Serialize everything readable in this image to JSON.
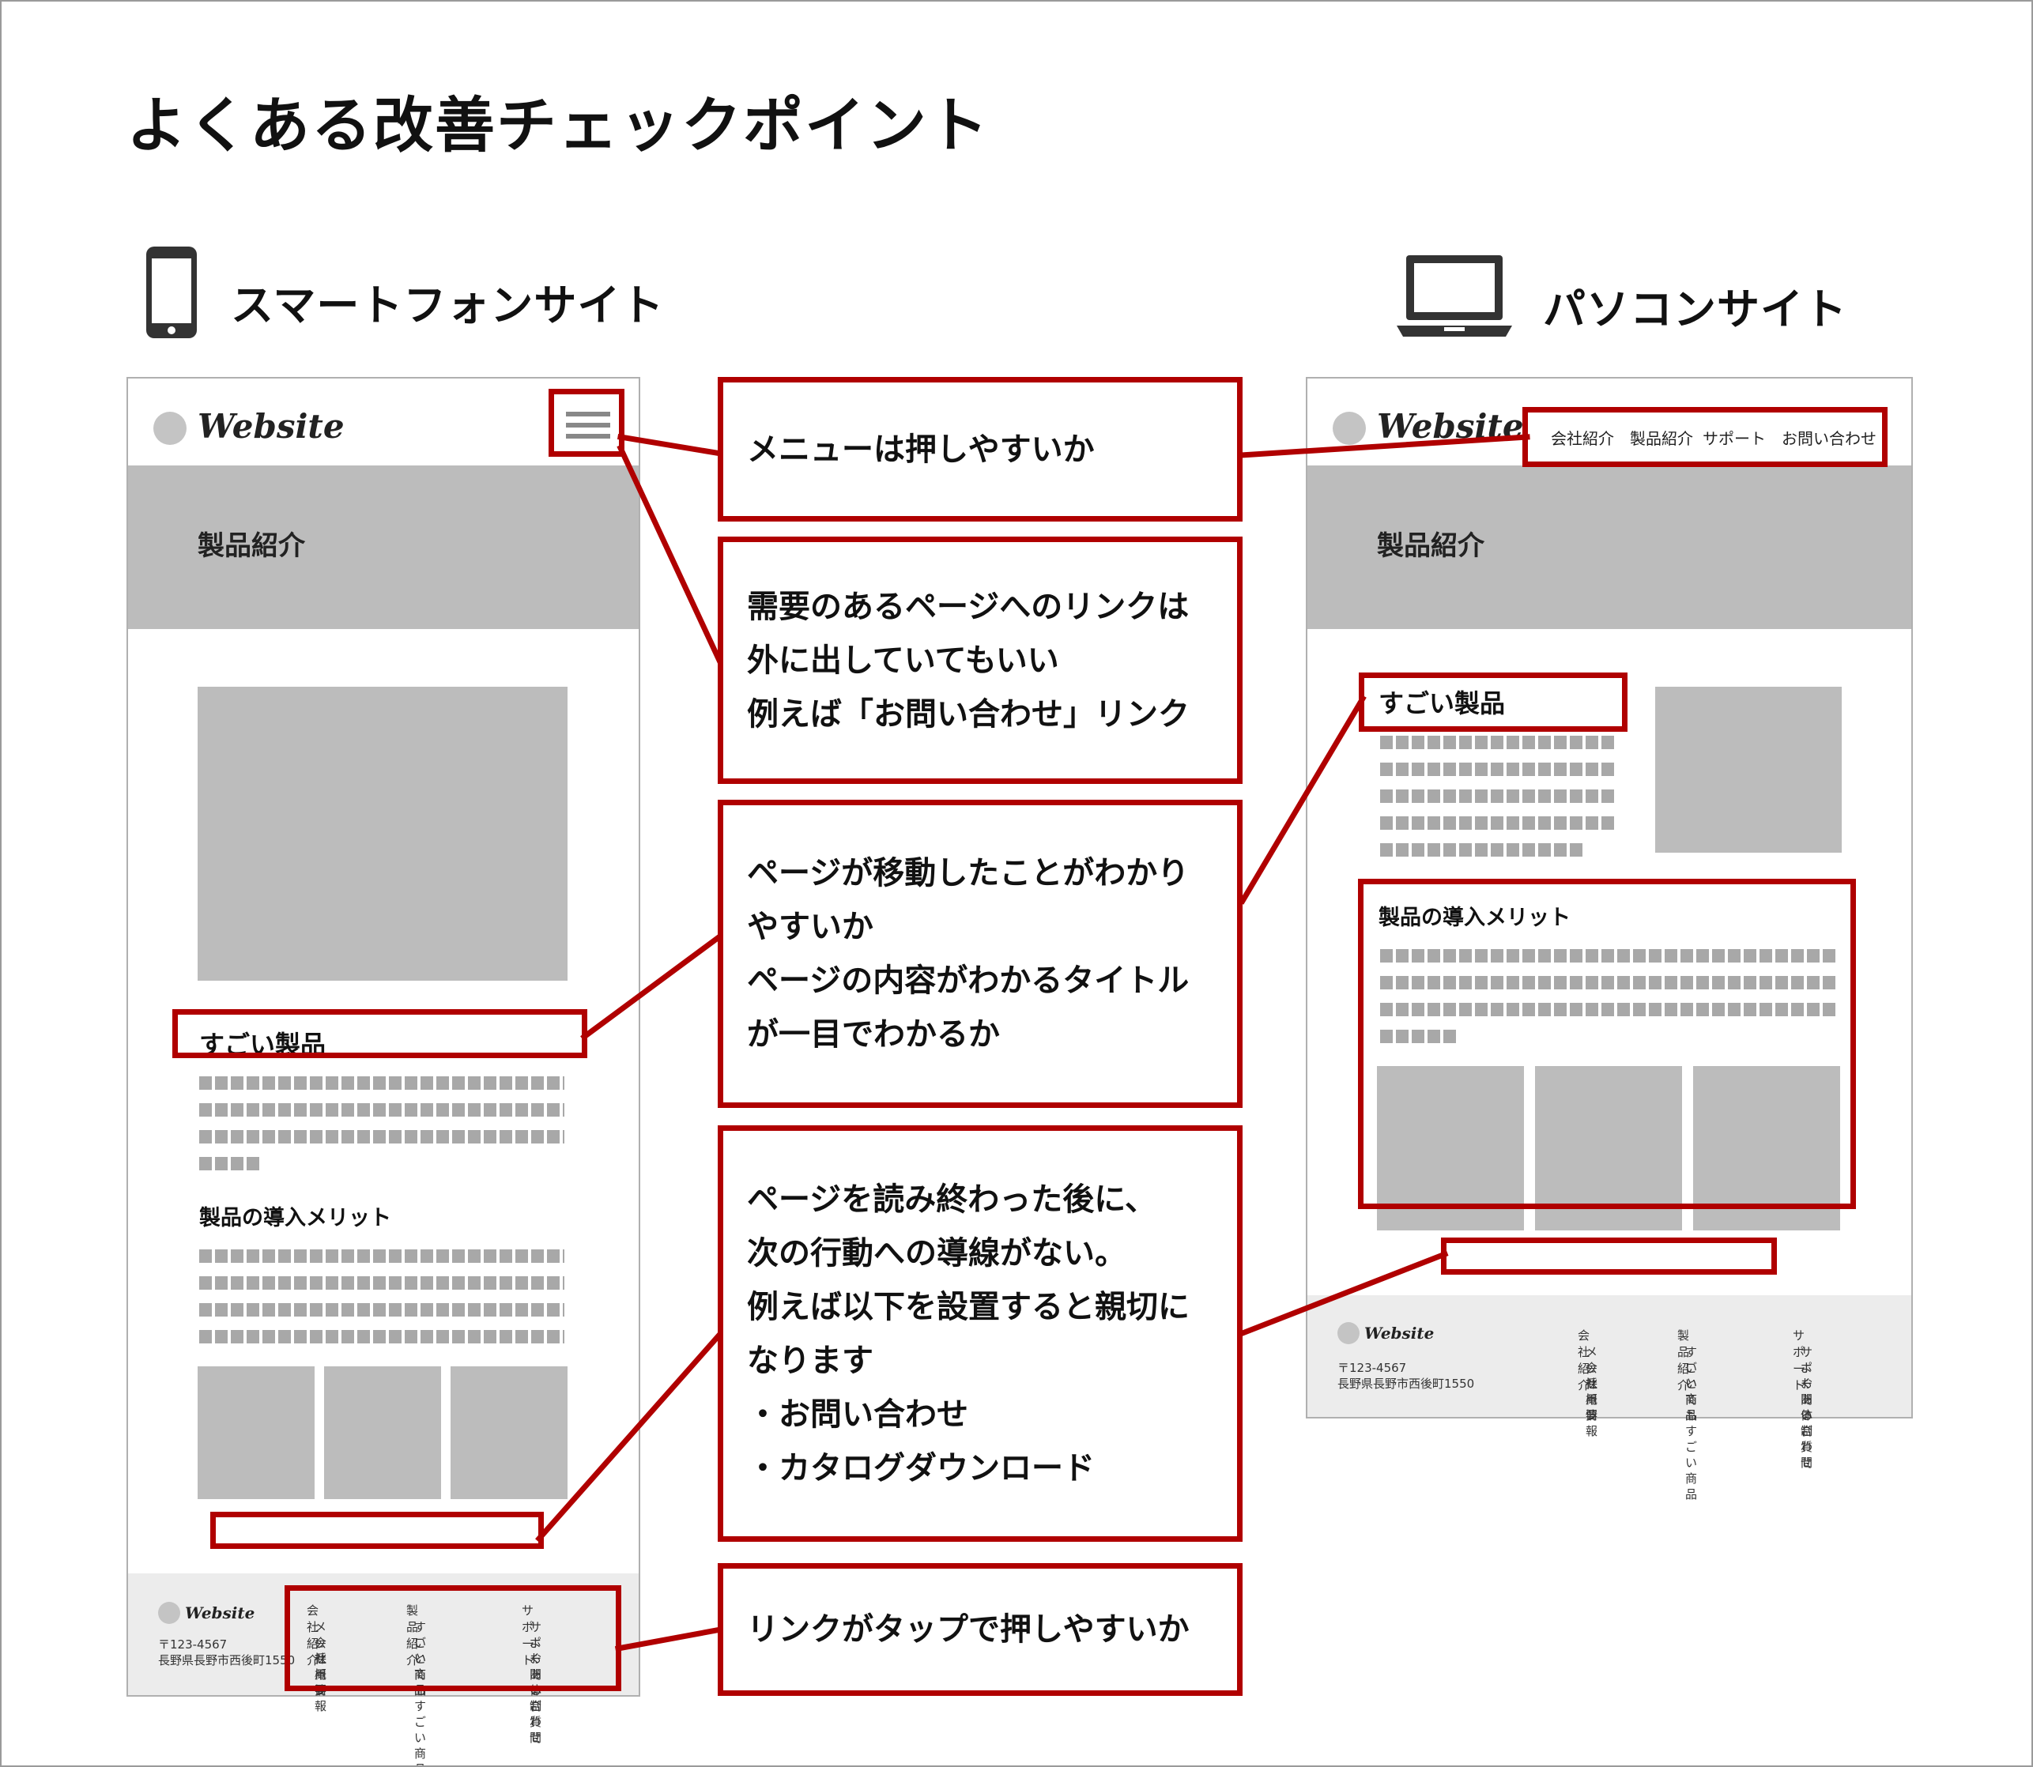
{
  "title": "よくある改善チェックポイント",
  "sections": {
    "smartphone": "スマートフォンサイト",
    "pc": "パソコンサイト"
  },
  "icons": {
    "smartphone": "smartphone-icon",
    "laptop": "laptop-icon"
  },
  "colors": {
    "accent": "#b00000",
    "placeholder": "#bcbcbc",
    "footer": "#ececec"
  },
  "mock": {
    "logo": "Website",
    "hero": "製品紹介",
    "product_heading": "すごい製品",
    "merit_heading": "製品の導入メリット",
    "pc_nav": [
      "会社紹介",
      "製品紹介",
      "サポート",
      "お問い合わせ"
    ],
    "footer": {
      "postal": "〒123-4567",
      "address": "長野県長野市西後町1550",
      "cols": [
        {
          "head": "会社紹介",
          "items": [
            "メッセージ",
            "会社概要",
            "採用情報"
          ]
        },
        {
          "head": "製品紹介",
          "items": [
            "すごい商品",
            "いい商品",
            "とてもすごい商品"
          ]
        },
        {
          "head": "サポート",
          "items": [
            "サポート体制",
            "よくあるご質問",
            "お問い合わせ"
          ]
        }
      ]
    }
  },
  "callouts": [
    {
      "lines": [
        "メニューは押しやすいか"
      ]
    },
    {
      "lines": [
        "需要のあるページへのリンクは",
        "外に出していてもいい",
        "例えば「お問い合わせ」リンク"
      ]
    },
    {
      "lines": [
        "ページが移動したことがわかり",
        "やすいか",
        "ページの内容がわかるタイトル",
        "が一目でわかるか"
      ]
    },
    {
      "lines": [
        "ページを読み終わった後に、",
        "次の行動への導線がない。",
        "例えば以下を設置すると親切に",
        "なります",
        "・お問い合わせ",
        "・カタログダウンロード"
      ]
    },
    {
      "lines": [
        "リンクがタップで押しやすいか"
      ]
    }
  ]
}
